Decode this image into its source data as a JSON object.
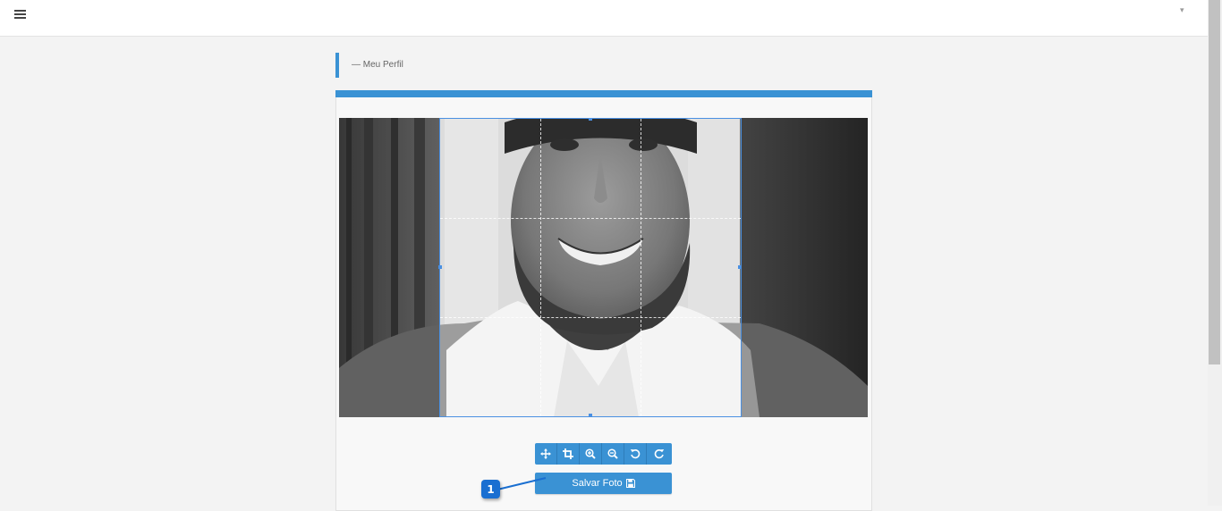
{
  "breadcrumb": {
    "text": "— Meu Perfil"
  },
  "topbar": {
    "user_menu_caret": "▾"
  },
  "toolbar": {
    "tools": [
      {
        "icon": "move-arrows-icon"
      },
      {
        "icon": "crop-icon"
      },
      {
        "icon": "zoom-in-icon"
      },
      {
        "icon": "zoom-out-icon"
      },
      {
        "icon": "rotate-left-icon"
      },
      {
        "icon": "rotate-right-icon"
      }
    ]
  },
  "save_button": {
    "label": "Salvar Foto",
    "icon": "floppy-disk-icon"
  },
  "annotation": {
    "number": "1"
  },
  "colors": {
    "accent": "#3a92d4",
    "annotation": "#1a6fd1",
    "crop_border": "#4a90e2"
  }
}
